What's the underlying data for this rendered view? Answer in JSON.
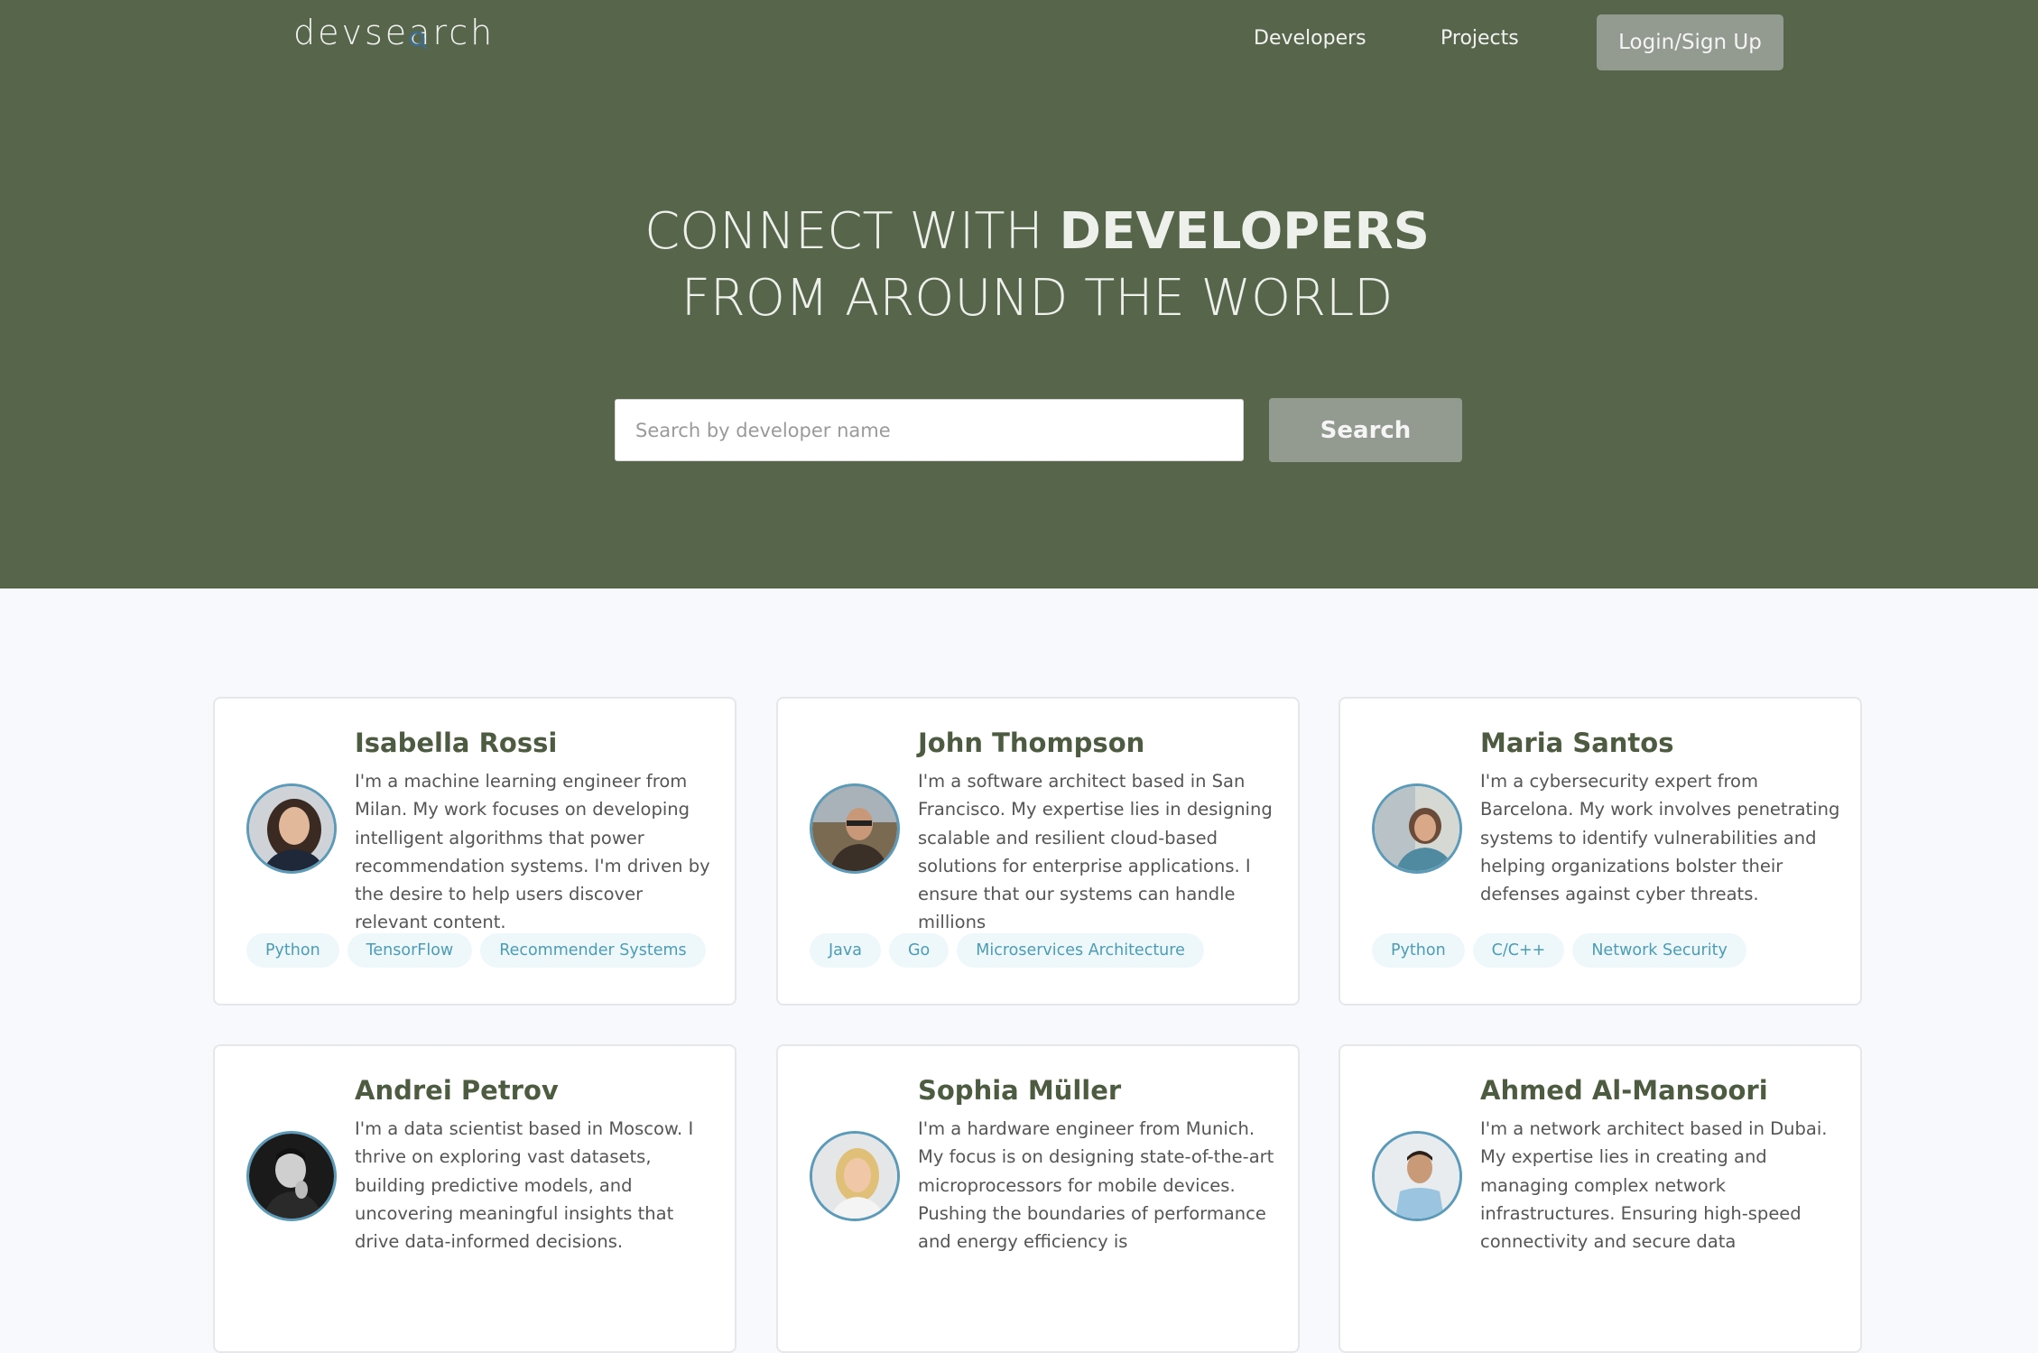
{
  "nav": {
    "logo": "devsearch",
    "logo_pre": "devse",
    "logo_lens": "a",
    "logo_post": "rch",
    "links": [
      "Developers",
      "Projects"
    ],
    "login": "Login/Sign Up"
  },
  "hero": {
    "line1_light": "CONNECT WITH ",
    "line1_bold": "DEVELOPERS",
    "line2": "FROM AROUND THE WORLD",
    "search_placeholder": "Search by developer name",
    "search_button": "Search"
  },
  "developers": [
    {
      "name": "Isabella Rossi",
      "bio": "I'm a machine learning engineer from Milan. My work focuses on developing intelligent algorithms that power recommendation systems. I'm driven by the desire to help users discover relevant content.",
      "tags": [
        "Python",
        "TensorFlow",
        "Recommender Systems"
      ]
    },
    {
      "name": "John Thompson",
      "bio": "I'm a software architect based in San Francisco. My expertise lies in designing scalable and resilient cloud-based solutions for enterprise applications. I ensure that our systems can handle millions",
      "tags": [
        "Java",
        "Go",
        "Microservices Architecture"
      ]
    },
    {
      "name": "Maria Santos",
      "bio": "I'm a cybersecurity expert from Barcelona. My work involves penetrating systems to identify vulnerabilities and helping organizations bolster their defenses against cyber threats.",
      "tags": [
        "Python",
        "C/C++",
        "Network Security"
      ]
    },
    {
      "name": "Andrei Petrov",
      "bio": "I'm a data scientist based in Moscow. I thrive on exploring vast datasets, building predictive models, and uncovering meaningful insights that drive data-informed decisions.",
      "tags": []
    },
    {
      "name": "Sophia Müller",
      "bio": "I'm a hardware engineer from Munich. My focus is on designing state-of-the-art microprocessors for mobile devices. Pushing the boundaries of performance and energy efficiency is",
      "tags": []
    },
    {
      "name": "Ahmed Al-Mansoori",
      "bio": "I'm a network architect based in Dubai. My expertise lies in creating and managing complex network infrastructures. Ensuring high-speed connectivity and secure data",
      "tags": []
    }
  ],
  "colors": {
    "header_bg": "#57654a",
    "accent_green": "#4d5b40",
    "button_gray": "#939a90",
    "tag_bg": "#eef8fb",
    "tag_text": "#4c9cb5",
    "avatar_ring": "#5b9ab8"
  }
}
